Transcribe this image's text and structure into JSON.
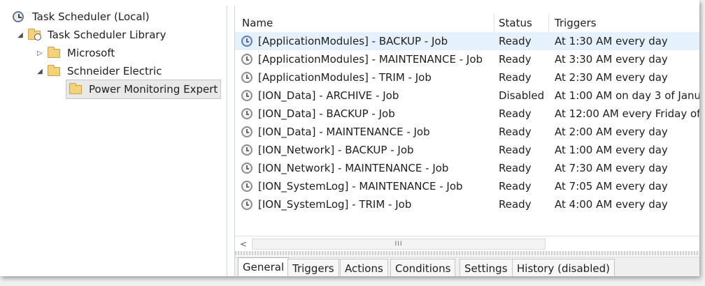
{
  "tree": {
    "items": [
      {
        "label": "Task Scheduler (Local)",
        "expander": "",
        "icon": "task-scheduler-clock-icon"
      },
      {
        "label": "Task Scheduler Library",
        "expander": "◢",
        "icon": "folder-clock-icon"
      },
      {
        "label": "Microsoft",
        "expander": "▷",
        "icon": "folder-icon"
      },
      {
        "label": "Schneider Electric",
        "expander": "◢",
        "icon": "folder-icon"
      },
      {
        "label": "Power Monitoring Expert",
        "expander": "",
        "icon": "folder-icon",
        "selected": true
      }
    ]
  },
  "table": {
    "columns": [
      "Name",
      "Status",
      "Triggers"
    ],
    "rows": [
      {
        "name": "[ApplicationModules] - BACKUP - Job",
        "status": "Ready",
        "trigger": "At 1:30 AM every day",
        "selected": true
      },
      {
        "name": "[ApplicationModules] - MAINTENANCE - Job",
        "status": "Ready",
        "trigger": "At 3:30 AM every day"
      },
      {
        "name": "[ApplicationModules] - TRIM - Job",
        "status": "Ready",
        "trigger": "At 2:30 AM every day"
      },
      {
        "name": "[ION_Data] - ARCHIVE - Job",
        "status": "Disabled",
        "trigger": "At 1:00 AM  on day 3 of Janu"
      },
      {
        "name": "[ION_Data] - BACKUP - Job",
        "status": "Ready",
        "trigger": "At 12:00 AM every Friday of"
      },
      {
        "name": "[ION_Data] - MAINTENANCE - Job",
        "status": "Ready",
        "trigger": "At 2:00 AM every day"
      },
      {
        "name": "[ION_Network] - BACKUP - Job",
        "status": "Ready",
        "trigger": "At 1:00 AM every day"
      },
      {
        "name": "[ION_Network] - MAINTENANCE - Job",
        "status": "Ready",
        "trigger": "At 7:30 AM every day"
      },
      {
        "name": "[ION_SystemLog] - MAINTENANCE - Job",
        "status": "Ready",
        "trigger": "At 7:05 AM every day"
      },
      {
        "name": "[ION_SystemLog] - TRIM - Job",
        "status": "Ready",
        "trigger": "At 4:00 AM every day"
      }
    ]
  },
  "scrollbar": {
    "left_arrow": "<",
    "thumb_grip": "III"
  },
  "tabs": [
    {
      "label": "General",
      "active": true
    },
    {
      "label": "Triggers"
    },
    {
      "label": "Actions"
    },
    {
      "label": "Conditions"
    },
    {
      "label": "Settings"
    },
    {
      "label": "History (disabled)"
    }
  ]
}
